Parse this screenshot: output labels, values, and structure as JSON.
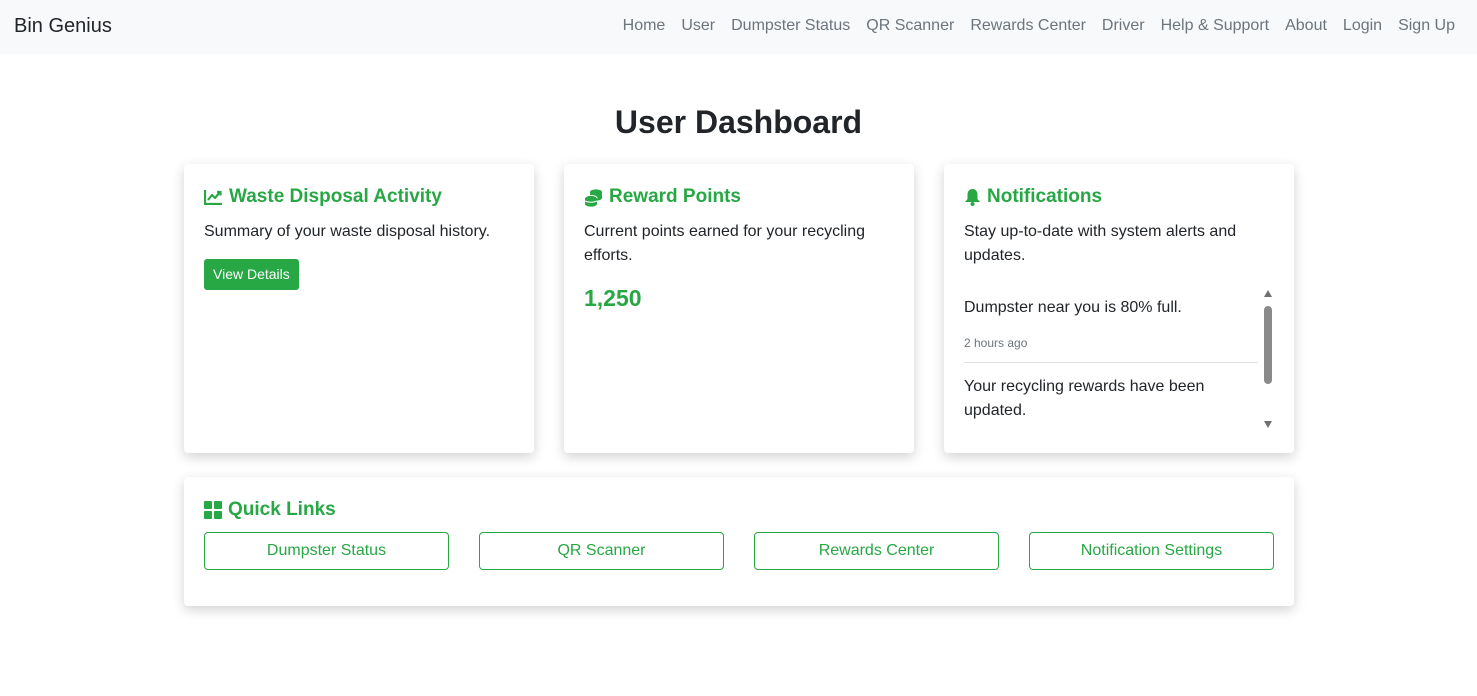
{
  "navbar": {
    "brand": "Bin Genius",
    "links": [
      "Home",
      "User",
      "Dumpster Status",
      "QR Scanner",
      "Rewards Center",
      "Driver",
      "Help & Support",
      "About",
      "Login",
      "Sign Up"
    ]
  },
  "page": {
    "title": "User Dashboard"
  },
  "colors": {
    "accent": "#28a745",
    "navbar_bg": "#f8f9fa",
    "muted": "#6c757d"
  },
  "cards": {
    "waste": {
      "icon": "chart-line-icon",
      "title": "Waste Disposal Activity",
      "text": "Summary of your waste disposal history.",
      "button": "View Details"
    },
    "rewards": {
      "icon": "coins-icon",
      "title": "Reward Points",
      "text": "Current points earned for your recycling efforts.",
      "points": "1,250"
    },
    "notifications": {
      "icon": "bell-icon",
      "title": "Notifications",
      "text": "Stay up-to-date with system alerts and updates.",
      "items": [
        {
          "message": "Dumpster near you is 80% full.",
          "time": "2 hours ago"
        },
        {
          "message": "Your recycling rewards have been updated.",
          "time": ""
        }
      ]
    }
  },
  "quick_links": {
    "icon": "grid-icon",
    "title": "Quick Links",
    "buttons": [
      "Dumpster Status",
      "QR Scanner",
      "Rewards Center",
      "Notification Settings"
    ]
  }
}
